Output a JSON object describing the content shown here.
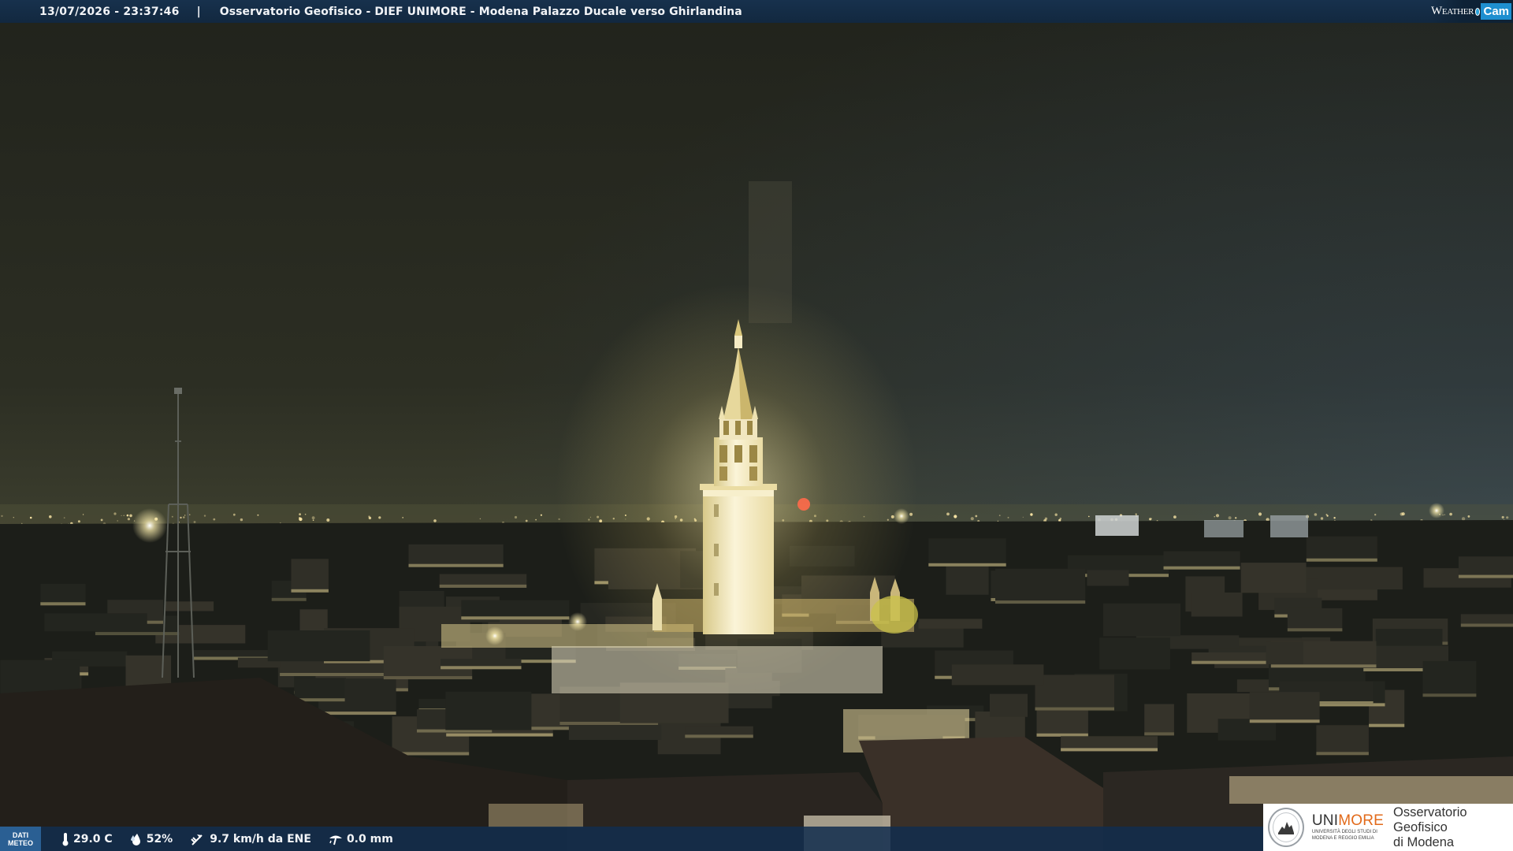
{
  "header": {
    "datetime": "13/07/2026 - 23:37:46",
    "separator": "|",
    "station": "Osservatorio Geofisico - DIEF UNIMORE - Modena Palazzo Ducale verso Ghirlandina"
  },
  "brand": {
    "word": "Weather",
    "cam": "Cam"
  },
  "weather_bar": {
    "badge_line1": "DATI",
    "badge_line2": "METEO",
    "temperature": "29.0 C",
    "humidity": "52%",
    "wind": "9.7 km/h da ENE",
    "rain": "0.0 mm"
  },
  "logo": {
    "uni": "UNI",
    "more": "MORE",
    "sub_line1": "UNIVERSITÀ DEGLI STUDI DI",
    "sub_line2": "MODENA E REGGIO EMILIA",
    "osserv_line1": "Osservatorio Geofisico",
    "osserv_line2": "di Modena"
  },
  "colors": {
    "sky_top": "#22241e",
    "sky_horizon": "#3a3d2f",
    "tower": "#f3ead0",
    "tower_glow": "#e8d27a",
    "city_lights": "#ffe9a6",
    "bar_blue": "#12283f"
  },
  "icons": {
    "temperature": "thermometer-icon",
    "humidity": "droplet-icon",
    "wind": "wind-vane-icon",
    "rain": "rain-gauge-icon"
  }
}
